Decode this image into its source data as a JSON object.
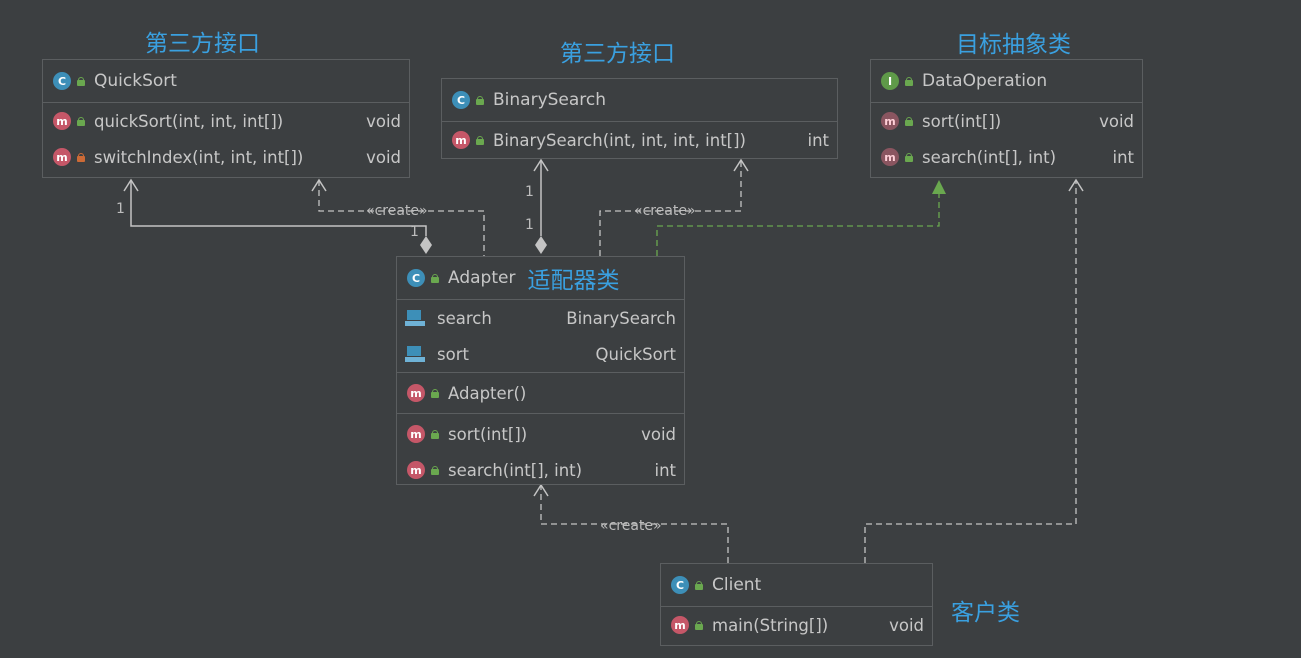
{
  "labels": {
    "quicksort_cn": "第三方接口",
    "binarysearch_cn": "第三方接口",
    "dataop_cn": "目标抽象类",
    "adapter_cn": "适配器类",
    "client_cn": "客户类"
  },
  "quicksort": {
    "name": "QuickSort",
    "methods": [
      {
        "name": "quickSort(int, int, int[])",
        "type": "void"
      },
      {
        "name": "switchIndex(int, int, int[])",
        "type": "void"
      }
    ]
  },
  "binarysearch": {
    "name": "BinarySearch",
    "methods": [
      {
        "name": "BinarySearch(int, int, int, int[])",
        "type": "int"
      }
    ]
  },
  "dataoperation": {
    "name": "DataOperation",
    "methods": [
      {
        "name": "sort(int[])",
        "type": "void"
      },
      {
        "name": "search(int[], int)",
        "type": "int"
      }
    ]
  },
  "adapter": {
    "name": "Adapter",
    "fields": [
      {
        "name": "search",
        "type": "BinarySearch"
      },
      {
        "name": "sort",
        "type": "QuickSort"
      }
    ],
    "constructors": [
      {
        "name": "Adapter()"
      }
    ],
    "methods": [
      {
        "name": "sort(int[])",
        "type": "void"
      },
      {
        "name": "search(int[], int)",
        "type": "int"
      }
    ]
  },
  "client": {
    "name": "Client",
    "methods": [
      {
        "name": "main(String[])",
        "type": "void"
      }
    ]
  },
  "connectors": {
    "create": "«create»",
    "one": "1"
  },
  "icons": {
    "class": "C",
    "interface": "I",
    "method": "m"
  },
  "colors": {
    "background": "#3c3f41",
    "label_blue": "#3aa0e0",
    "realization_green": "#6aa84f",
    "line": "#c4c4c4"
  }
}
